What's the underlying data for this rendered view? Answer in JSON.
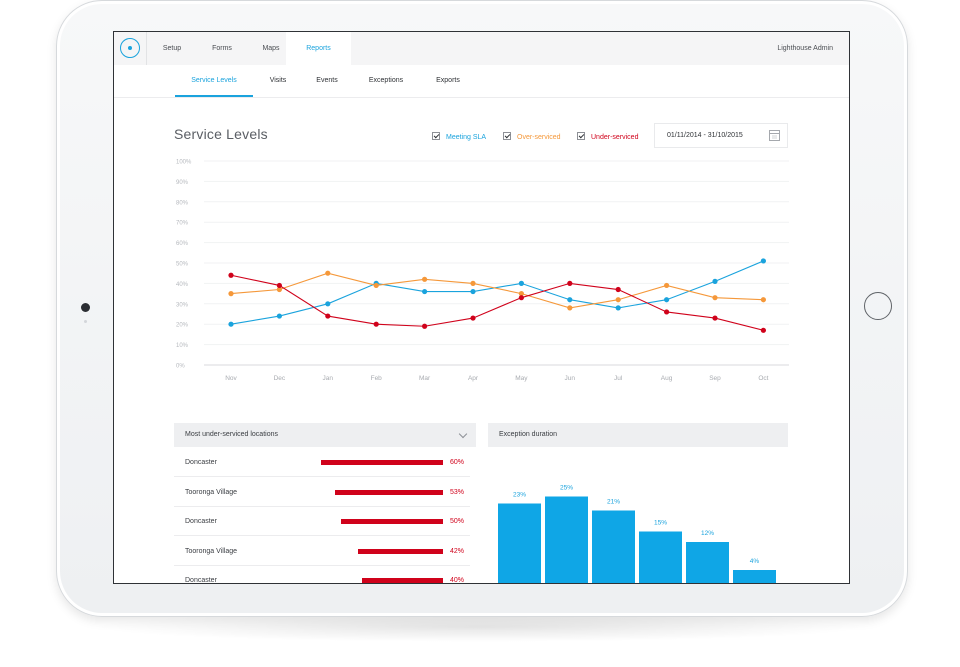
{
  "nav": {
    "items": [
      {
        "label": "Setup",
        "active": false
      },
      {
        "label": "Forms",
        "active": false
      },
      {
        "label": "Maps",
        "active": false
      },
      {
        "label": "Reports",
        "active": true
      }
    ],
    "user": "Lighthouse Admin"
  },
  "subnav": {
    "items": [
      {
        "label": "Service Levels",
        "active": true
      },
      {
        "label": "Visits",
        "active": false
      },
      {
        "label": "Events",
        "active": false
      },
      {
        "label": "Exceptions",
        "active": false
      },
      {
        "label": "Exports",
        "active": false
      }
    ]
  },
  "page": {
    "title": "Service Levels"
  },
  "filters": {
    "meeting": "Meeting SLA",
    "over": "Over-serviced",
    "under": "Under-serviced",
    "date_range": "01/11/2014 - 31/10/2015"
  },
  "colors": {
    "meeting": "#1aa3dd",
    "over": "#f5983a",
    "under": "#d0021b"
  },
  "chart_data": [
    {
      "type": "line",
      "categories": [
        "Nov",
        "Dec",
        "Jan",
        "Feb",
        "Mar",
        "Apr",
        "May",
        "Jun",
        "Jul",
        "Aug",
        "Sep",
        "Oct"
      ],
      "y_ticks": [
        "100%",
        "90%",
        "80%",
        "70%",
        "60%",
        "50%",
        "40%",
        "30%",
        "20%",
        "10%",
        "0%"
      ],
      "ylim": [
        0,
        100
      ],
      "series": [
        {
          "name": "Meeting SLA",
          "color": "#1aa3dd",
          "values": [
            20,
            24,
            30,
            40,
            36,
            36,
            40,
            32,
            28,
            32,
            41,
            51
          ]
        },
        {
          "name": "Over-serviced",
          "color": "#f5983a",
          "values": [
            35,
            37,
            45,
            39,
            42,
            40,
            35,
            28,
            32,
            39,
            33,
            32
          ]
        },
        {
          "name": "Under-serviced",
          "color": "#d0021b",
          "values": [
            44,
            39,
            24,
            20,
            19,
            23,
            33,
            40,
            37,
            26,
            23,
            17
          ]
        }
      ]
    },
    {
      "type": "bar",
      "title": "Most under-serviced locations",
      "categories": [
        "Doncaster",
        "Tooronga Village",
        "Doncaster",
        "Tooronga Village",
        "Doncaster"
      ],
      "values": [
        60,
        53,
        50,
        42,
        40
      ],
      "labels": [
        "60%",
        "53%",
        "50%",
        "42%",
        "40%"
      ]
    },
    {
      "type": "bar",
      "title": "Exception duration",
      "values": [
        23,
        25,
        21,
        15,
        12,
        4
      ],
      "labels": [
        "23%",
        "25%",
        "21%",
        "15%",
        "12%",
        "4%"
      ]
    }
  ],
  "panels": {
    "locations": {
      "title": "Most under-serviced locations"
    },
    "exceptions": {
      "title": "Exception duration"
    }
  }
}
